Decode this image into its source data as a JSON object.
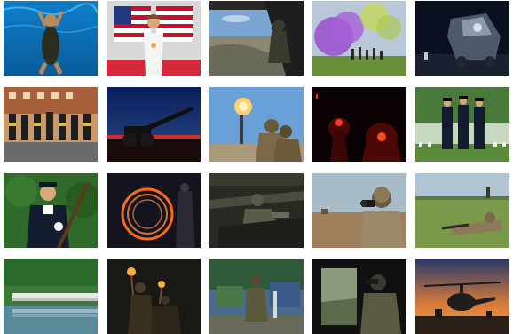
{
  "gallery": {
    "columns": 5,
    "rows": 4,
    "tiles": [
      {
        "id": 1,
        "scene": "swimmer-underwater",
        "colors": [
          "#0a6fb8",
          "#24b4e8"
        ]
      },
      {
        "id": 2,
        "scene": "athlete-with-flag",
        "colors": [
          "#c8102e",
          "#ffffff"
        ]
      },
      {
        "id": 3,
        "scene": "aircraft-door-view",
        "colors": [
          "#3a6ea5",
          "#6b6b5a"
        ]
      },
      {
        "id": 4,
        "scene": "purple-smoke-training",
        "colors": [
          "#8a4fbf",
          "#6a8f3a"
        ]
      },
      {
        "id": 5,
        "scene": "night-vehicle-operation",
        "colors": [
          "#0b1020",
          "#4c5a6a"
        ]
      },
      {
        "id": 6,
        "scene": "formation-run",
        "colors": [
          "#2d2d2d",
          "#9a7b5a"
        ]
      },
      {
        "id": 7,
        "scene": "howitzer-at-dusk",
        "colors": [
          "#0c2a6a",
          "#b8212a"
        ]
      },
      {
        "id": 8,
        "scene": "mortar-firing",
        "colors": [
          "#6aa0d8",
          "#d8a070"
        ]
      },
      {
        "id": 9,
        "scene": "red-light-night-ops",
        "colors": [
          "#180404",
          "#d41f14"
        ]
      },
      {
        "id": 10,
        "scene": "honor-guard-cemetery",
        "colors": [
          "#2e6a2e",
          "#101828"
        ]
      },
      {
        "id": 11,
        "scene": "ceremonial-rifle-guard",
        "colors": [
          "#2f6a2a",
          "#141c30"
        ]
      },
      {
        "id": 12,
        "scene": "light-painting-circle",
        "colors": [
          "#1a1a2a",
          "#ff6a1a"
        ]
      },
      {
        "id": 13,
        "scene": "vehicle-interior-crew",
        "colors": [
          "#2a2a24",
          "#6a6a5a"
        ]
      },
      {
        "id": 14,
        "scene": "binocular-observer",
        "colors": [
          "#a0b4c0",
          "#8a7a5a"
        ]
      },
      {
        "id": 15,
        "scene": "prone-field-position",
        "colors": [
          "#a8c0d0",
          "#7a9a4a"
        ]
      },
      {
        "id": 16,
        "scene": "riverside-formation",
        "colors": [
          "#3a7a3a",
          "#c8d0d8"
        ]
      },
      {
        "id": 17,
        "scene": "torch-march-night",
        "colors": [
          "#1a1a1a",
          "#e0a040"
        ]
      },
      {
        "id": 18,
        "scene": "obstacle-course",
        "colors": [
          "#2a4a6a",
          "#3a5a2a"
        ]
      },
      {
        "id": 19,
        "scene": "helicopter-door-gunner",
        "colors": [
          "#111111",
          "#7a8a6a"
        ]
      },
      {
        "id": 20,
        "scene": "helicopter-at-sunset",
        "colors": [
          "#2a3a6a",
          "#f09030"
        ]
      }
    ]
  }
}
